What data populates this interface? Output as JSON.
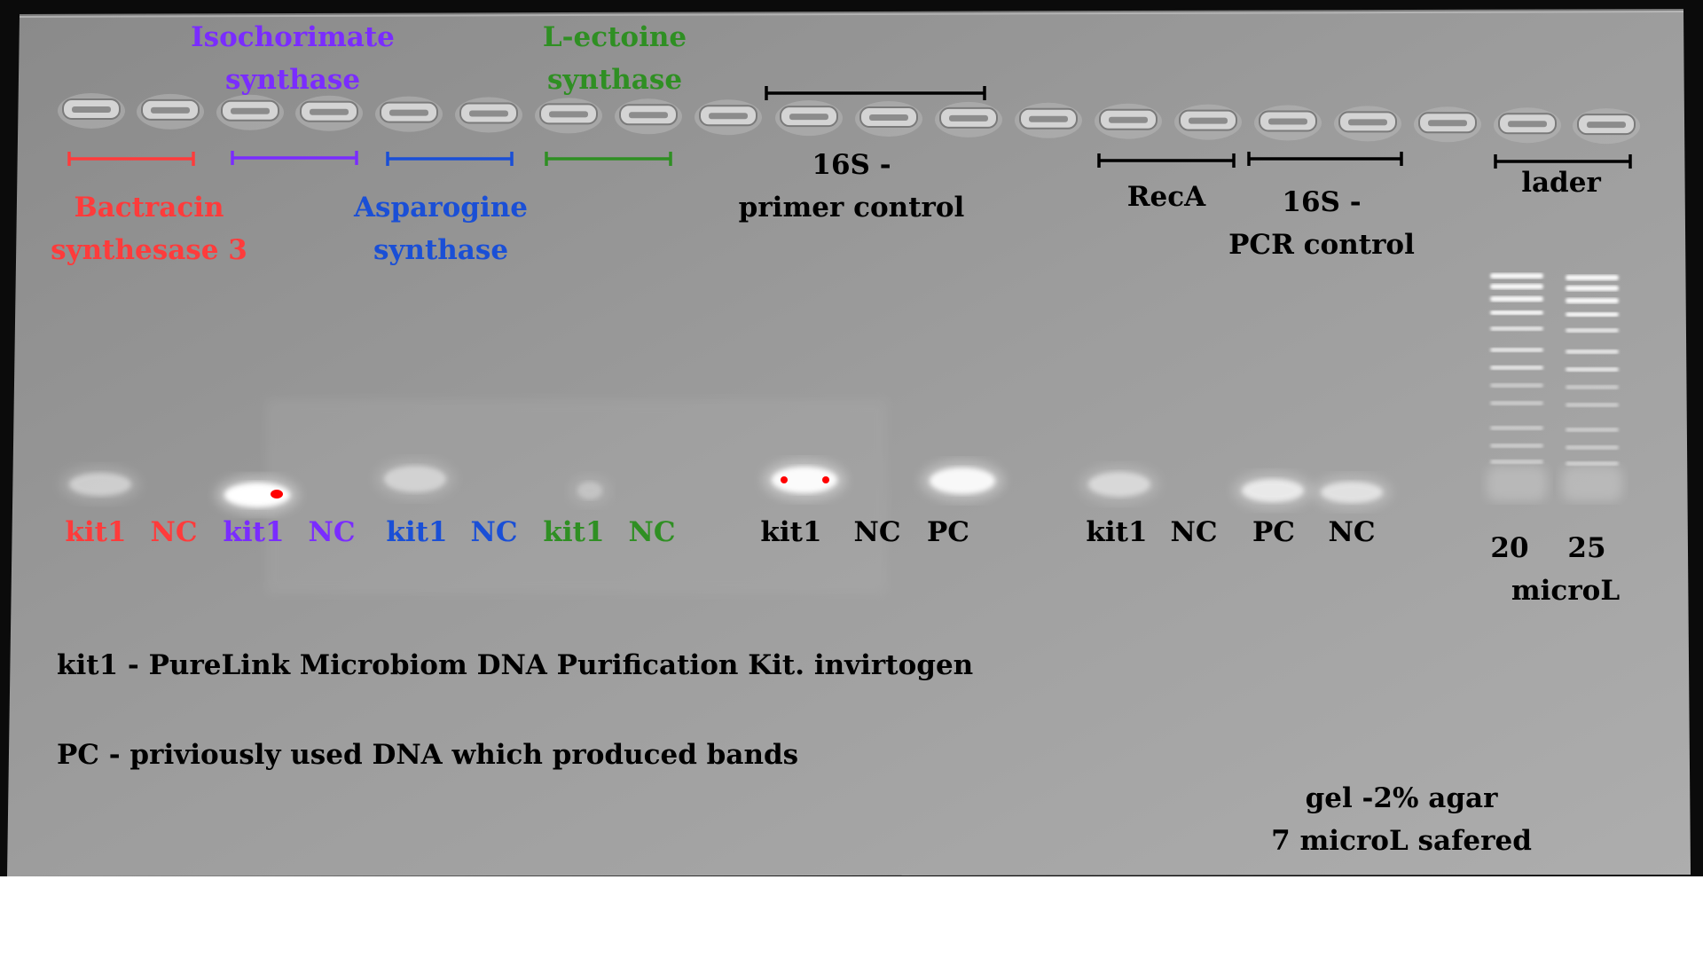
{
  "gene_groups": [
    {
      "id": "bactracin",
      "color": "#ff3b3b",
      "name_line1": "Bactracin",
      "name_line2": "synthesase 3",
      "lane1": "kit1",
      "lane2": "NC"
    },
    {
      "id": "isochorimate",
      "color": "#7a2cff",
      "name_line1": "Isochorimate",
      "name_line2": "synthase",
      "lane1": "kit1",
      "lane2": "NC"
    },
    {
      "id": "asparogine",
      "color": "#1a4fd6",
      "name_line1": "Asparogine",
      "name_line2": "synthase",
      "lane1": "kit1",
      "lane2": "NC"
    },
    {
      "id": "lectoine",
      "color": "#2f8f23",
      "name_line1": "L-ectoine",
      "name_line2": "synthase",
      "lane1": "kit1",
      "lane2": "NC"
    }
  ],
  "primer_control": {
    "line1": "16S -",
    "line2": "primer control",
    "lanes": [
      "kit1",
      "NC",
      "PC"
    ]
  },
  "reca": {
    "name": "RecA",
    "lanes": [
      "kit1",
      "NC"
    ]
  },
  "pcr_control": {
    "line1": "16S -",
    "line2": "PCR control",
    "lanes": [
      "PC",
      "NC"
    ]
  },
  "ladder": {
    "name": "lader",
    "vol1": "20",
    "vol2": "25",
    "unit": "microL"
  },
  "notes": {
    "kit_note": "kit1 - PureLink Microbiom DNA Purification Kit. invirtogen",
    "pc_note": "PC - priviously used DNA which produced bands",
    "gel_line1": "gel -2% agar",
    "gel_line2": "7 microL safered"
  },
  "colors": {
    "label_black": "#000000",
    "saturation_red": "#ff0000",
    "background": "#ffffff"
  }
}
